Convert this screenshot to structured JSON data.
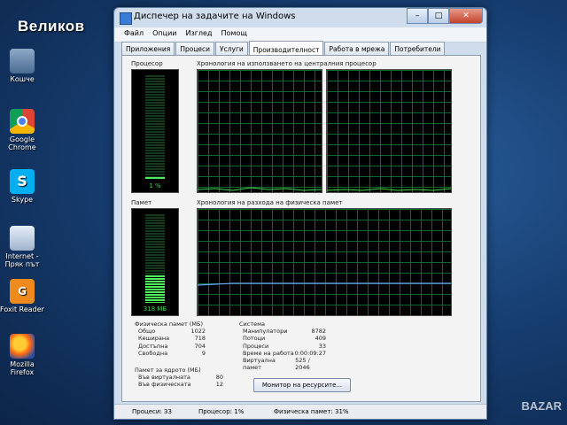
{
  "overlay_title": "Великов",
  "watermark": "BAZAR",
  "desktop": {
    "icons": [
      {
        "label": "Кошче",
        "icon": "recycle-bin-icon"
      },
      {
        "label": "Google Chrome",
        "icon": "chrome-icon"
      },
      {
        "label": "Skype",
        "icon": "skype-icon"
      },
      {
        "label": "Internet - Пряк път",
        "icon": "internet-shortcut-icon"
      },
      {
        "label": "Foxit Reader",
        "icon": "foxit-icon"
      },
      {
        "label": "Mozilla Firefox",
        "icon": "firefox-icon"
      }
    ]
  },
  "window": {
    "title": "Диспечер на задачите на Windows",
    "menu": [
      "Файл",
      "Опции",
      "Изглед",
      "Помощ"
    ],
    "tabs": [
      "Приложения",
      "Процеси",
      "Услуги",
      "Производителност",
      "Работа в мрежа",
      "Потребители"
    ],
    "active_tab": "Производителност"
  },
  "performance": {
    "cpu_label": "Процесор",
    "cpu_value": "1 %",
    "cpu_history_label": "Хронология на използването на централния процесор",
    "memory_label": "Памет",
    "memory_value": "318 МБ",
    "memory_history_label": "Хронология на разхода на физическа памет",
    "cpu_fraction": 0.01,
    "memory_fraction": 0.31
  },
  "physical_memory": {
    "title": "Физическа памет (МБ)",
    "rows": [
      {
        "k": "Общо",
        "v": "1022"
      },
      {
        "k": "Кеширана",
        "v": "718"
      },
      {
        "k": "Достъпна",
        "v": "704"
      },
      {
        "k": "Свободна",
        "v": "9"
      }
    ]
  },
  "kernel_memory": {
    "title": "Памет за ядрото (МБ)",
    "rows": [
      {
        "k": "Във виртуалната",
        "v": "80"
      },
      {
        "k": "Във физическата",
        "v": "12"
      }
    ]
  },
  "system": {
    "title": "Система",
    "rows": [
      {
        "k": "Манипулатори",
        "v": "8782"
      },
      {
        "k": "Потоци",
        "v": "409"
      },
      {
        "k": "Процеси",
        "v": "33"
      },
      {
        "k": "Време на работа",
        "v": "0:00:09:27"
      },
      {
        "k": "Виртуална памет",
        "v": "525 / 2046"
      }
    ]
  },
  "resource_monitor_button": "Монитор на ресурсите...",
  "status": {
    "processes": "Процеси: 33",
    "cpu": "Процесор: 1%",
    "memory": "Физическа памет: 31%"
  }
}
